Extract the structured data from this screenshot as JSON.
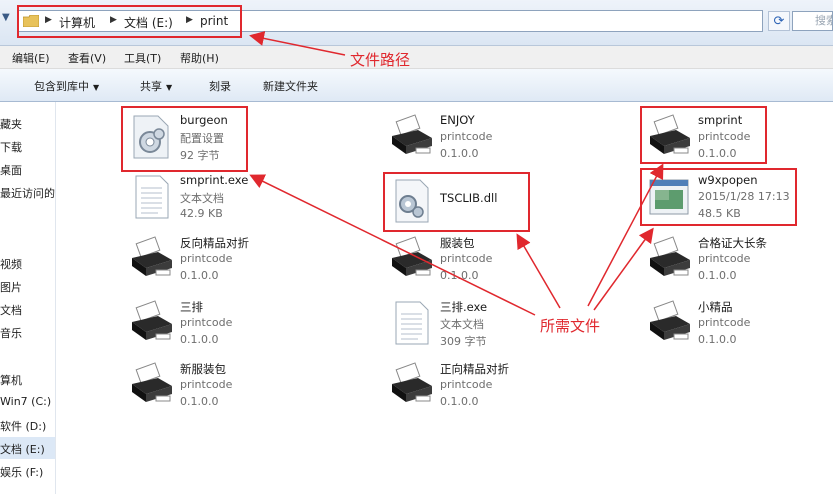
{
  "address_bar": {
    "path": [
      "计算机",
      "文档 (E:)",
      "print"
    ],
    "search_placeholder": "搜索"
  },
  "menu": [
    "编辑(E)",
    "查看(V)",
    "工具(T)",
    "帮助(H)"
  ],
  "toolbar": {
    "include_library": "包含到库中",
    "share": "共享",
    "burn": "刻录",
    "new_folder": "新建文件夹"
  },
  "sidebar": {
    "items": [
      "藏夹",
      "下载",
      "桌面",
      "最近访问的位置",
      "视频",
      "图片",
      "文档",
      "音乐",
      "算机",
      "Win7 (C:)",
      "软件 (D:)",
      "文档 (E:)",
      "娱乐 (F:)"
    ],
    "selected": "文档 (E:)"
  },
  "files": [
    {
      "name": "burgeon",
      "line2": "配置设置",
      "line3": "92 字节",
      "icon": "config-settings-icon"
    },
    {
      "name": "ENJOY",
      "line2": "printcode",
      "line3": "0.1.0.0",
      "icon": "printer-icon"
    },
    {
      "name": "smprint",
      "line2": "printcode",
      "line3": "0.1.0.0",
      "icon": "printer-icon"
    },
    {
      "name": "smprint.exe",
      "line2": "文本文档",
      "line3": "42.9 KB",
      "icon": "text-document-icon"
    },
    {
      "name": "TSCLIB.dll",
      "line2": "",
      "line3": "",
      "icon": "dll-file-icon"
    },
    {
      "name": "w9xpopen",
      "line2": "2015/1/28 17:13",
      "line3": "48.5 KB",
      "icon": "application-icon"
    },
    {
      "name": "反向精品对折",
      "line2": "printcode",
      "line3": "0.1.0.0",
      "icon": "printer-icon"
    },
    {
      "name": "服装包",
      "line2": "printcode",
      "line3": "0.1.0.0",
      "icon": "printer-icon"
    },
    {
      "name": "合格证大长条",
      "line2": "printcode",
      "line3": "0.1.0.0",
      "icon": "printer-icon"
    },
    {
      "name": "三排",
      "line2": "printcode",
      "line3": "0.1.0.0",
      "icon": "printer-icon"
    },
    {
      "name": "三排.exe",
      "line2": "文本文档",
      "line3": "309 字节",
      "icon": "text-document-icon"
    },
    {
      "name": "小精品",
      "line2": "printcode",
      "line3": "0.1.0.0",
      "icon": "printer-icon"
    },
    {
      "name": "新服装包",
      "line2": "printcode",
      "line3": "0.1.0.0",
      "icon": "printer-icon"
    },
    {
      "name": "正向精品对折",
      "line2": "printcode",
      "line3": "0.1.0.0",
      "icon": "printer-icon"
    }
  ],
  "annotations": {
    "path_label": "文件路径",
    "files_label": "所需文件",
    "color": "#e0282e"
  }
}
